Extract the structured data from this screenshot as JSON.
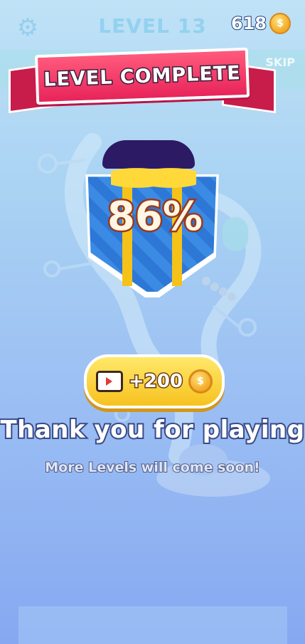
{
  "top_bar": {
    "level_title": "LEVEL 13",
    "coins": "618",
    "coin_symbol": "$",
    "skip_label": "SKIP"
  },
  "banner": {
    "title": "LEVEL COMPLETE"
  },
  "gift": {
    "progress_text": "86%",
    "progress_value": 86
  },
  "reward_button": {
    "label": "+200",
    "coin_symbol": "$",
    "icon": "video-play-icon"
  },
  "message": {
    "title": "Thank you for playing",
    "subtitle": "More Levels will come soon!"
  },
  "colors": {
    "ribbon": "#e8245a",
    "button": "#f6c21f",
    "background_top": "#bfe2f6",
    "background_bottom": "#86a8f2"
  }
}
